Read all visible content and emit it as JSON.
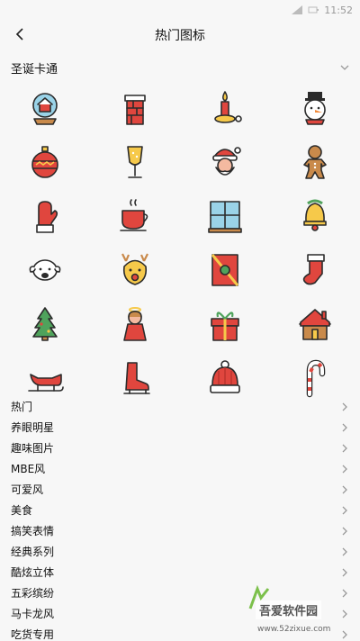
{
  "statusbar": {
    "time": "11:52"
  },
  "header": {
    "title": "热门图标"
  },
  "section": {
    "title": "圣诞卡通"
  },
  "icons": [
    {
      "name": "snow-globe-icon"
    },
    {
      "name": "chimney-icon"
    },
    {
      "name": "candle-icon"
    },
    {
      "name": "snowman-icon"
    },
    {
      "name": "ornament-ball-icon"
    },
    {
      "name": "champagne-glass-icon"
    },
    {
      "name": "santa-icon"
    },
    {
      "name": "gingerbread-man-icon"
    },
    {
      "name": "mitten-icon"
    },
    {
      "name": "tea-cup-icon"
    },
    {
      "name": "window-icon"
    },
    {
      "name": "bell-icon"
    },
    {
      "name": "sheep-icon"
    },
    {
      "name": "reindeer-icon"
    },
    {
      "name": "gift-card-icon"
    },
    {
      "name": "stocking-icon"
    },
    {
      "name": "christmas-tree-icon"
    },
    {
      "name": "angel-icon"
    },
    {
      "name": "gift-box-icon"
    },
    {
      "name": "house-icon"
    },
    {
      "name": "sleigh-icon"
    },
    {
      "name": "ice-skate-icon"
    },
    {
      "name": "knit-hat-icon"
    },
    {
      "name": "candy-cane-icon"
    }
  ],
  "categories": [
    {
      "label": "热门"
    },
    {
      "label": "养眼明星"
    },
    {
      "label": "趣味图片"
    },
    {
      "label": "MBE风"
    },
    {
      "label": "可爱风"
    },
    {
      "label": "美食"
    },
    {
      "label": "搞笑表情"
    },
    {
      "label": "经典系列"
    },
    {
      "label": "酷炫立体"
    },
    {
      "label": "五彩缤纷"
    },
    {
      "label": "马卡龙风"
    },
    {
      "label": "吃货专用"
    }
  ],
  "watermark": {
    "name": "吾爱软件园",
    "url": "www.52zixue.com"
  },
  "colors": {
    "red": "#e0463e",
    "outline": "#2b2b2b",
    "yellow": "#f6c94a",
    "green": "#4fa35c",
    "bg": "#f7f7f7"
  }
}
